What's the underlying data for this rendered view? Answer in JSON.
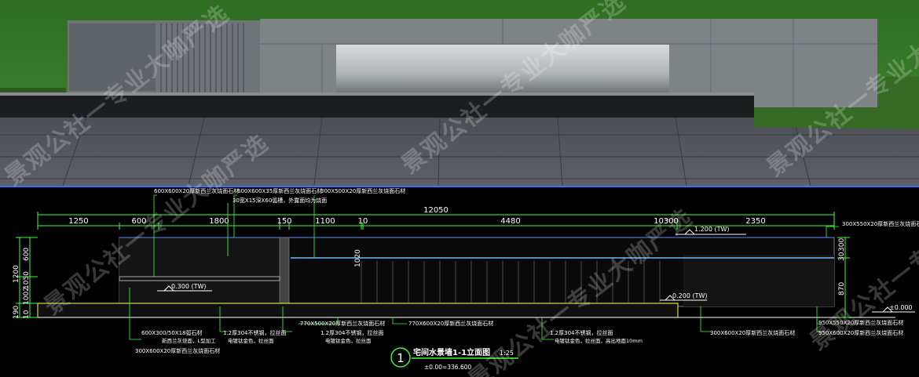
{
  "watermark": "景观公社一专业大咖严选",
  "drawing_title": "宅间水景墙1-1立面图",
  "drawing_scale": "1:25",
  "drawing_number": "1",
  "base_elevation": "±0.00=336.600",
  "dimensions_top": {
    "overall": "12050",
    "segments": [
      "1250",
      "600",
      "1800",
      "150",
      "1100",
      "10",
      "4480",
      "10300",
      "2350"
    ]
  },
  "dimensions_left": [
    "600",
    "1200",
    "1050",
    "100",
    "10",
    "190",
    "1002"
  ],
  "dimensions_right": [
    "30",
    "300",
    "870"
  ],
  "dim_1020": "1020",
  "levels": {
    "tw_1200": "1.200 (TW)",
    "tw_0300": "0.300 (TW)",
    "tw_0200": "0.200 (TW)",
    "zero": "±0.000"
  },
  "notes_top": [
    "600X600X20厚新西兰灰烧面石材",
    "600X600X35厚新西兰灰烧面石材",
    "30宽X15深X60弧槽，外露面均为烧面",
    "300X500X20厚新西兰灰烧面石材"
  ],
  "note_top_right": "300X550X20厚新西兰灰烧面石材",
  "notes_bottom": [
    "600X300/50X18弧石材",
    "新西兰灰烧面，L型加工",
    "300X600X20厚新西兰灰烧面石材",
    "1.2厚304不锈钢，拉丝面",
    "电镀钛金色，拉丝面",
    "770X500X20厚新西兰灰烧面石材",
    "1.2厚304不锈钢，拉丝面",
    "电镀钛金色，拉丝面",
    "770X600X20厚新西兰灰烧面石材",
    "1.2厚304不锈钢，拉丝面",
    "电镀钛金色，拉丝面，高出地面10mm",
    "300X600X20厚新西兰灰烧面石材",
    "950X550X20厚新西兰灰烧面石材",
    "950X600X20厚新西兰灰烧面石材"
  ]
}
